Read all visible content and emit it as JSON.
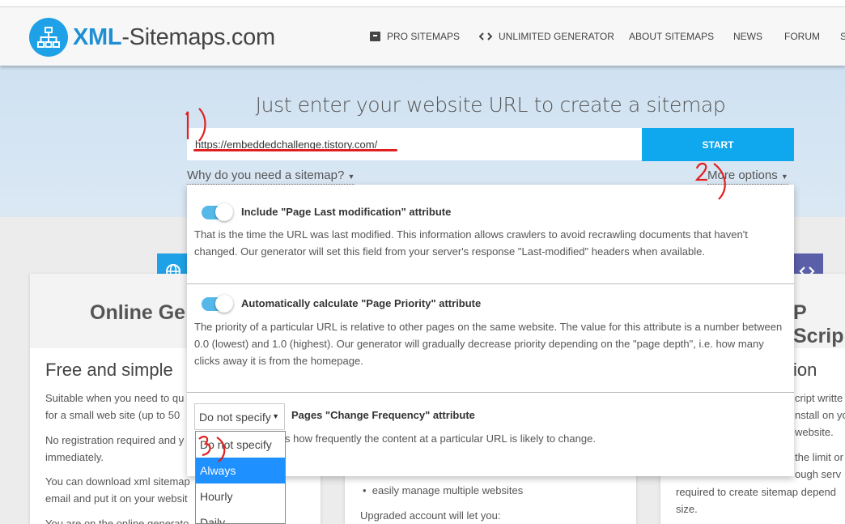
{
  "header": {
    "logo_text_bold": "XML",
    "logo_text_rest": "-Sitemaps.com",
    "nav": [
      {
        "label": "PRO SITEMAPS",
        "icon": "box-icon"
      },
      {
        "label": "UNLIMITED GENERATOR",
        "icon": "code-icon"
      },
      {
        "label": "ABOUT SITEMAPS"
      },
      {
        "label": "NEWS"
      },
      {
        "label": "FORUM"
      },
      {
        "label": "S"
      }
    ]
  },
  "hero": {
    "title": "Just enter your website URL to create a sitemap",
    "url_value": "https://embeddedchallenge.tistory.com/",
    "start_label": "START",
    "why_link": "Why do you need a sitemap?",
    "more_options_link": "More options"
  },
  "options": [
    {
      "title": "Include \"Page Last modification\" attribute",
      "desc": "That is the time the URL was last modified. This information allows crawlers to avoid recrawling documents that haven't changed. Our generator will set this field from your server's response \"Last-modified\" headers when available.",
      "enabled": true
    },
    {
      "title": "Automatically calculate \"Page Priority\" attribute",
      "desc": "The priority of a particular URL is relative to other pages on the same website. The value for this attribute is a number between 0.0 (lowest) and 1.0 (highest). Our generator will gradually decrease priority depending on the \"page depth\", i.e. how many clicks away it is from the homepage.",
      "enabled": true
    },
    {
      "title": "Pages \"Change Frequency\" attribute",
      "desc": "s how frequently the content at a particular URL is likely to change.",
      "select_value": "Do not specify"
    }
  ],
  "dropdown": {
    "items": [
      "Do not specify",
      "Always",
      "Hourly",
      "Daily"
    ],
    "highlighted": "Always"
  },
  "background": {
    "left_title": "Online Ge",
    "left_sub": "Free and simple",
    "left_p1a": "Suitable when you need to qu",
    "left_p1b": "for a small web site (up to 50",
    "left_p2a": "No registration required and y",
    "left_p2b": "immediately.",
    "left_p3a": "You can download xml sitemap",
    "left_p3b": "email and put it on your websit",
    "left_p4": "You are on the online generato",
    "mid_bullet": "easily manage multiple websites",
    "mid_p": "Upgraded account will let you:",
    "right_title": "P Scrip",
    "right_sub": "ion",
    "right_p1": "cript writte",
    "right_p2": "nstall on yo",
    "right_p3": "website.",
    "right_p4": "the limit or",
    "right_p5": "ough serv",
    "right_p6": "required to create sitemap depend",
    "right_p7": "size."
  },
  "annotations": [
    "1)",
    "2)",
    "3)"
  ],
  "colors": {
    "accent": "#0fa7ee",
    "annotation": "#e02020",
    "dropdown_highlight": "#1e90ff"
  }
}
